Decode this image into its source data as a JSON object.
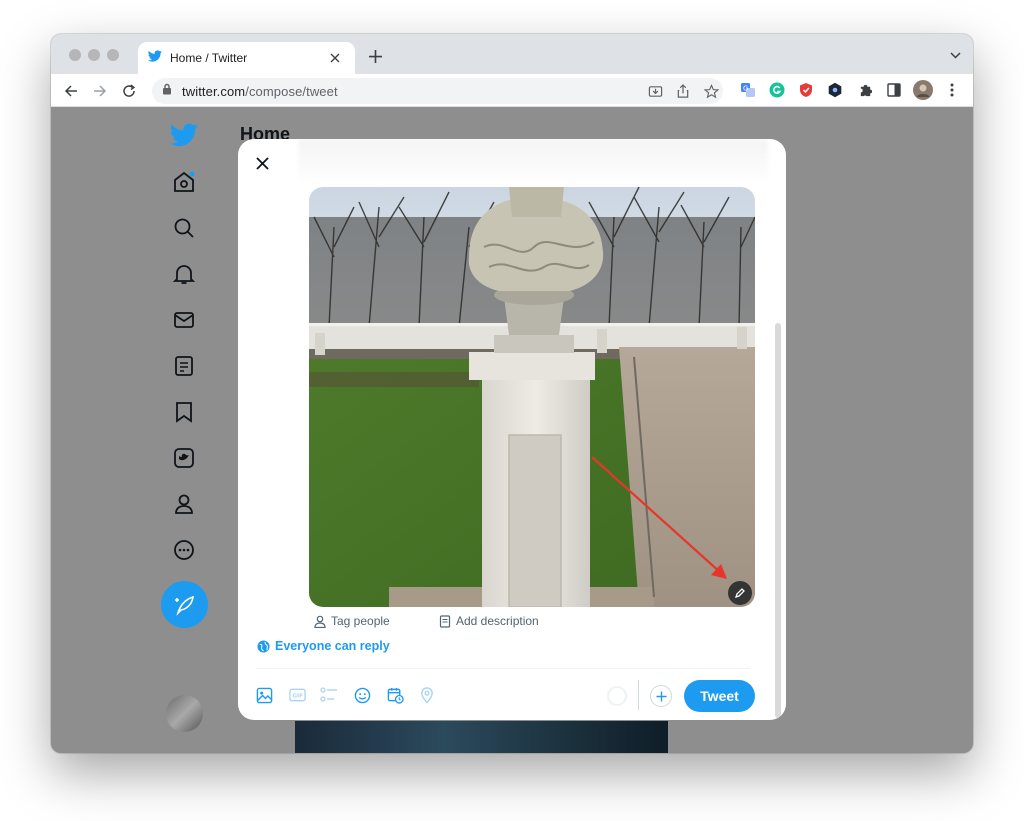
{
  "browser": {
    "tab_title": "Home / Twitter",
    "url_domain": "twitter.com",
    "url_path": "/compose/tweet"
  },
  "twitter": {
    "page_title": "Home",
    "brand_color": "#1d9bf0",
    "sidebar_icons": [
      "twitter-logo-icon",
      "home-icon",
      "explore-search-icon",
      "notifications-bell-icon",
      "messages-envelope-icon",
      "lists-icon",
      "bookmarks-icon",
      "twitter-blue-icon",
      "profile-icon",
      "more-circle-icon"
    ]
  },
  "compose": {
    "tag_people": "Tag people",
    "add_description": "Add description",
    "reply_setting": "Everyone can reply",
    "tweet_button": "Tweet"
  },
  "annotation": {
    "arrow_color": "#e8352b"
  }
}
